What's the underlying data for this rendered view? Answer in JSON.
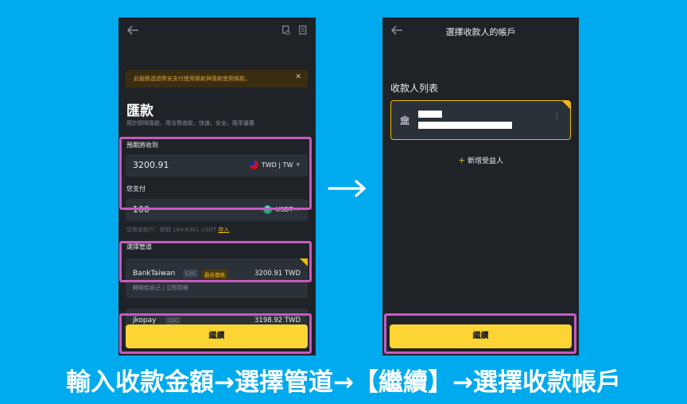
{
  "left_screen": {
    "notice": "此服務透過幣安支付使用條款與匯款使用條款。",
    "title": "匯款",
    "subtitle": "用於即時匯款，用法幣收款，快速，安全，匯率優惠",
    "receive_label": "預期將收到",
    "receive_amount": "3200.91",
    "receive_currency": "TWD | TW",
    "pay_label": "您支付",
    "pay_amount": "100",
    "pay_currency": "USDT",
    "available_text": "您資金帳戶：餘額 184.8381 USDT",
    "available_link": "存入",
    "channel_label": "選擇管道",
    "channels": [
      {
        "name": "BankTaiwan",
        "tag": "C2C",
        "badge": "最佳價格",
        "amount": "3200.91 TWD",
        "desc": "轉帳給自己 | 立即到帳"
      },
      {
        "name": "jkopay",
        "tag": "C2C",
        "amount": "3198.92 TWD"
      }
    ],
    "continue_label": "繼續"
  },
  "right_screen": {
    "title": "選擇收款人的帳戶",
    "list_label": "收款人列表",
    "add_label": "新增受益人",
    "continue_label": "繼續"
  },
  "caption": "輸入收款金額→選擇管道→【繼續】→選擇收款帳戶",
  "colors": {
    "background": "#00aaee",
    "accent": "#fcd535",
    "highlight_frame": "#b04ad9",
    "highlight_frame_alt": "#e8456e"
  },
  "icons": [
    "back-arrow-icon",
    "history-icon",
    "receipt-icon",
    "close-icon",
    "taiwan-flag-icon",
    "usdt-icon",
    "chevron-down-icon",
    "check-corner-icon",
    "bank-icon",
    "more-icon",
    "plus-icon",
    "right-arrow-icon"
  ]
}
